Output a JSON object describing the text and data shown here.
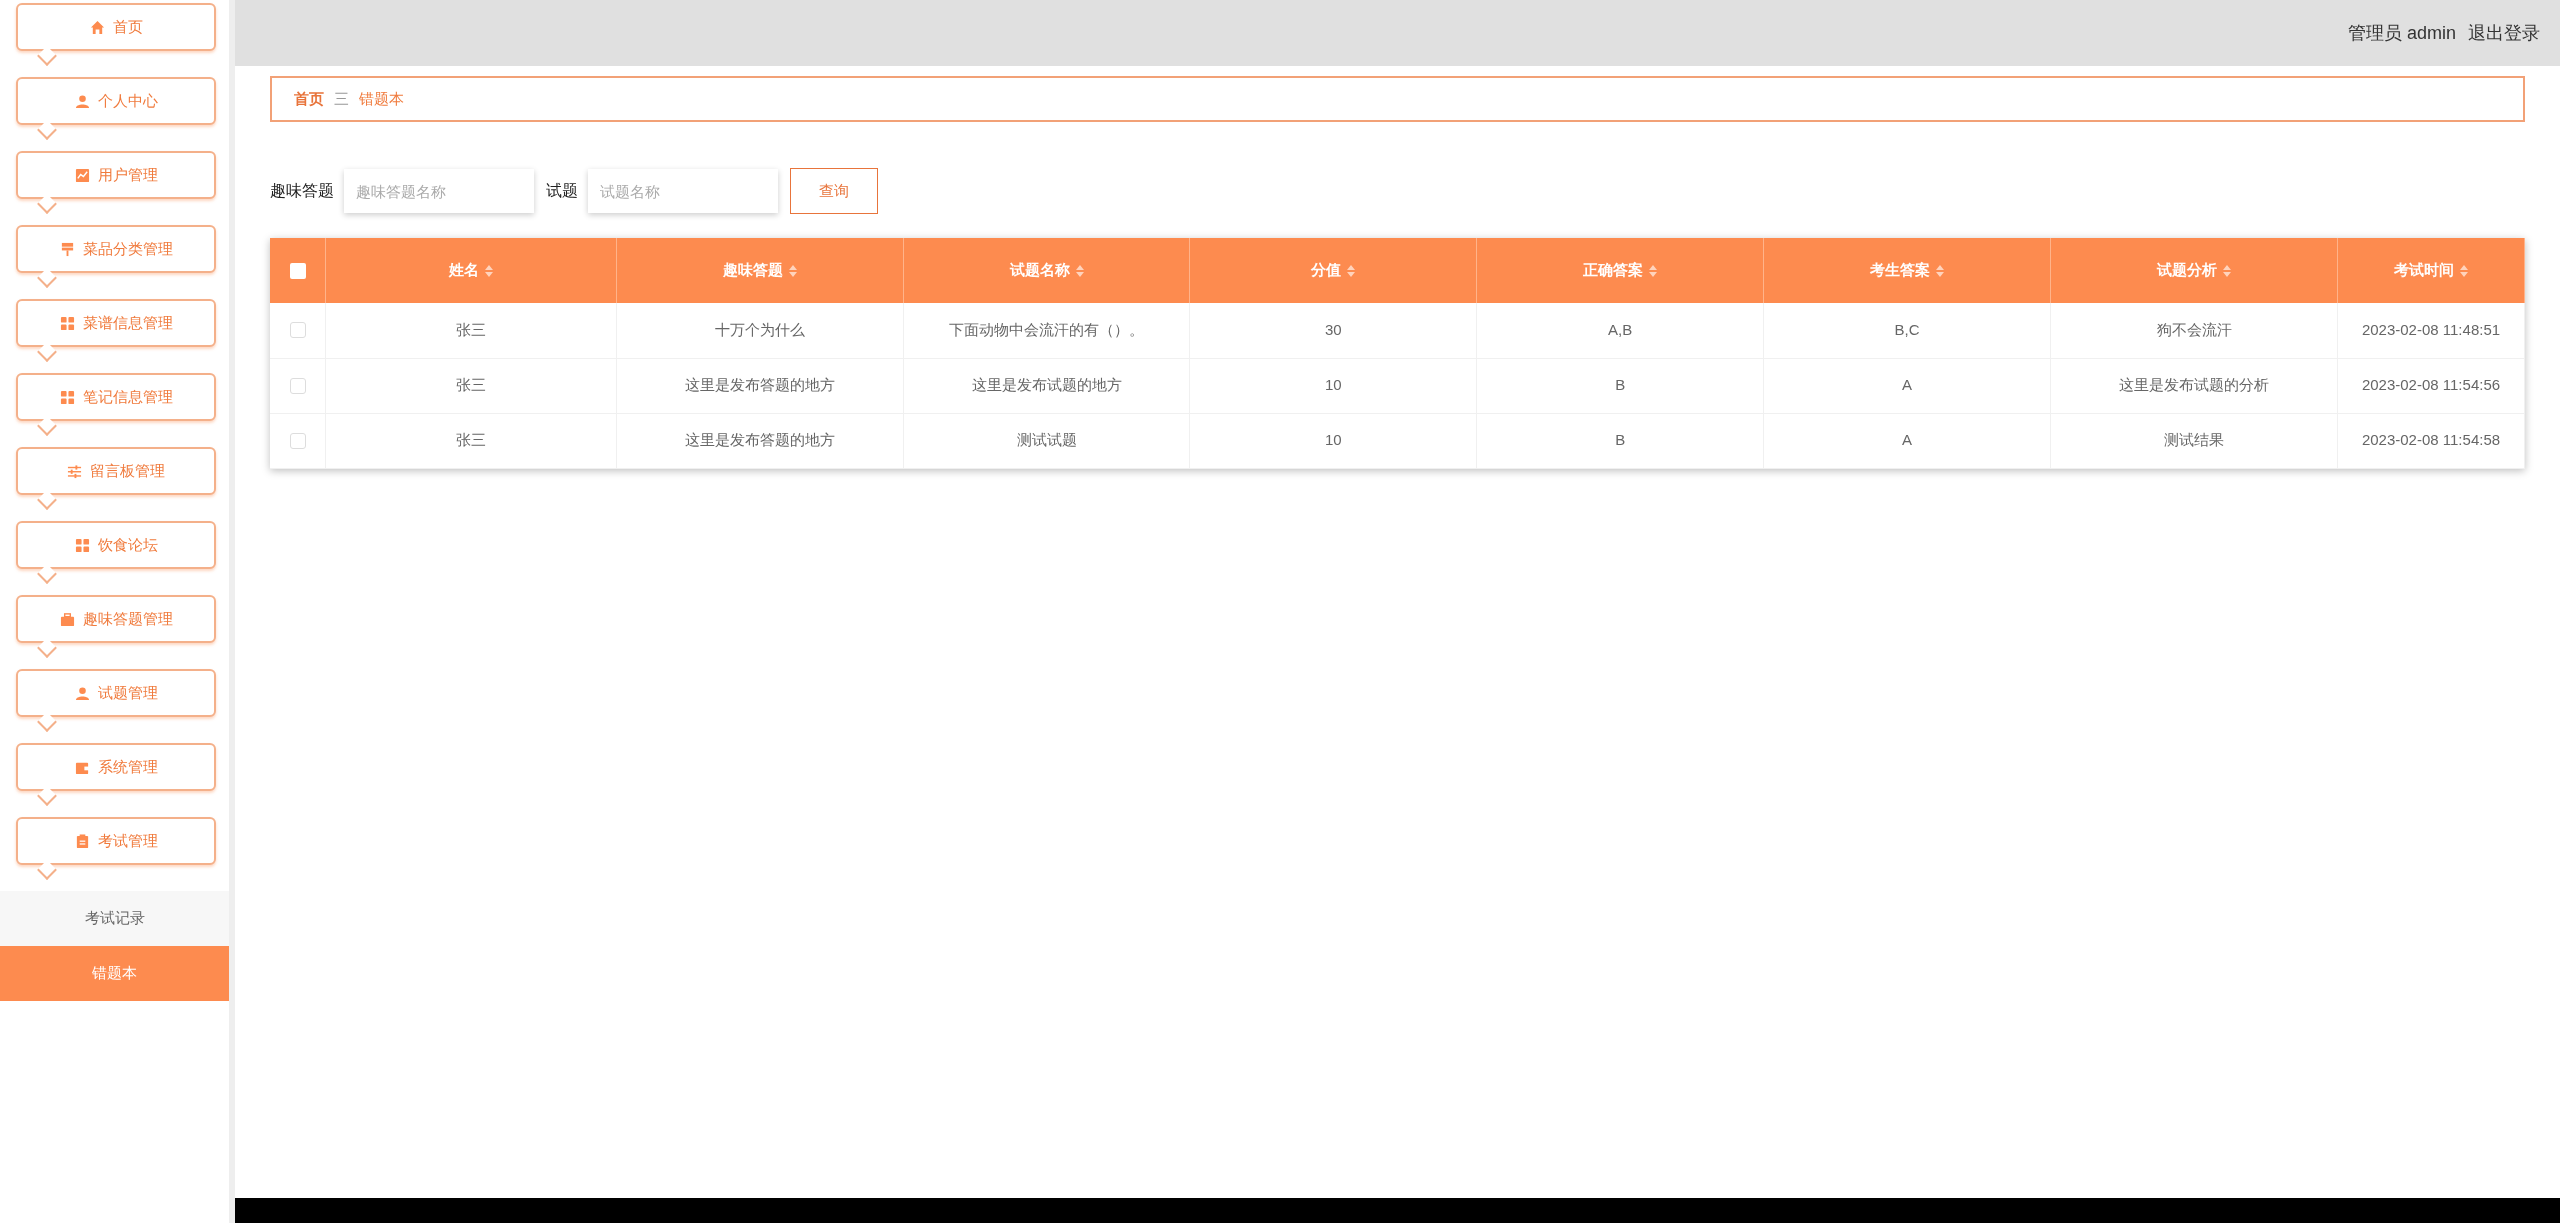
{
  "header": {
    "user": "管理员 admin",
    "logout": "退出登录"
  },
  "sidebar": {
    "items": [
      {
        "label": "首页"
      },
      {
        "label": "个人中心"
      },
      {
        "label": "用户管理"
      },
      {
        "label": "菜品分类管理"
      },
      {
        "label": "菜谱信息管理"
      },
      {
        "label": "笔记信息管理"
      },
      {
        "label": "留言板管理"
      },
      {
        "label": "饮食论坛"
      },
      {
        "label": "趣味答题管理"
      },
      {
        "label": "试题管理"
      },
      {
        "label": "系统管理"
      },
      {
        "label": "考试管理",
        "children": [
          {
            "label": "考试记录",
            "selected": false
          },
          {
            "label": "错题本",
            "selected": true
          }
        ]
      }
    ]
  },
  "breadcrumb": [
    {
      "label": "首页"
    },
    {
      "label": "错题本"
    }
  ],
  "breadcrumb_separator": "三",
  "search": {
    "fields": [
      {
        "label": "趣味答题",
        "placeholder": "趣味答题名称"
      },
      {
        "label": "试题",
        "placeholder": "试题名称"
      }
    ],
    "button": "查询"
  },
  "table": {
    "select_all_checked": false,
    "columns": [
      "姓名",
      "趣味答题",
      "试题名称",
      "分值",
      "正确答案",
      "考生答案",
      "试题分析",
      "考试时间"
    ],
    "rows": [
      {
        "checked": false,
        "cells": [
          "张三",
          "十万个为什么",
          "下面动物中会流汗的有（）。",
          "30",
          "A,B",
          "B,C",
          "狗不会流汗",
          "2023-02-08 11:48:51"
        ]
      },
      {
        "checked": false,
        "cells": [
          "张三",
          "这里是发布答题的地方",
          "这里是发布试题的地方",
          "10",
          "B",
          "A",
          "这里是发布试题的分析",
          "2023-02-08 11:54:56"
        ]
      },
      {
        "checked": false,
        "cells": [
          "张三",
          "这里是发布答题的地方",
          "测试试题",
          "10",
          "B",
          "A",
          "测试结果",
          "2023-02-08 11:54:58"
        ]
      }
    ]
  }
}
